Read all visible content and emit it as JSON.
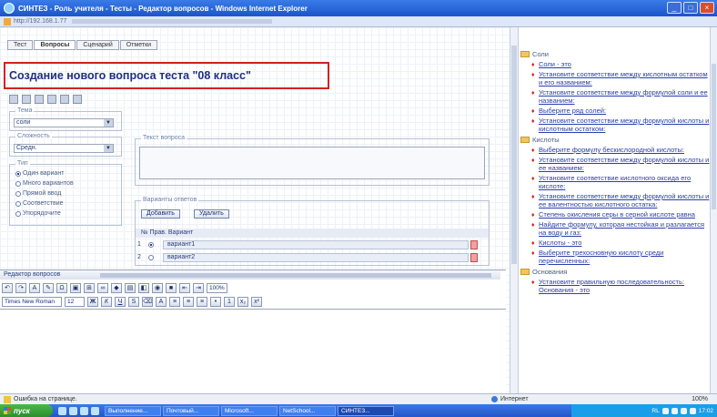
{
  "window": {
    "title": "СИНТЕЗ - Роль учителя - Тесты - Редактор вопросов - Windows Internet Explorer",
    "address": "http://192.168.1.77",
    "controls": [
      "_",
      "□",
      "×"
    ]
  },
  "tabs": [
    {
      "label": "Тест",
      "active": false
    },
    {
      "label": "Вопросы",
      "active": true
    },
    {
      "label": "Сценарий",
      "active": false
    },
    {
      "label": "Отметки",
      "active": false
    }
  ],
  "page_title": "Создание нового вопроса теста \"08 класс\"",
  "form": {
    "topic": {
      "legend": "Тема",
      "value": "соли"
    },
    "difficulty": {
      "legend": "Сложность",
      "value": "Средн."
    },
    "type": {
      "legend": "Тип",
      "options": [
        "Один вариант",
        "Много вариантов",
        "Прямой ввод",
        "Соответствие",
        "Упорядочите"
      ],
      "selected_index": 0
    },
    "question_text_legend": "Текст вопроса",
    "answers": {
      "legend": "Варианты ответов",
      "add_label": "Добавить",
      "delete_label": "Удалить",
      "header": "№ Прав. Вариант",
      "rows": [
        {
          "n": "1",
          "correct": true,
          "text": "вариант1"
        },
        {
          "n": "2",
          "correct": false,
          "text": "вариант2"
        }
      ]
    }
  },
  "editor": {
    "header": "Редактор вопросов",
    "font_name": "Times New Roman",
    "font_size": "12",
    "zoom": "100%",
    "row1_icons": [
      "undo-icon",
      "redo-icon",
      "font-color-icon",
      "highlight-icon",
      "special-char-icon",
      "image-icon",
      "table-icon",
      "link-icon",
      "flash-icon",
      "media-icon",
      "template-icon",
      "preview-icon",
      "source-icon",
      "outdent-icon",
      "indent-icon"
    ],
    "row2_icons": [
      "bold-icon",
      "italic-icon",
      "underline-icon",
      "strike-icon",
      "eraser-icon",
      "text-color-icon",
      "align-left-icon",
      "align-center-icon",
      "align-right-icon",
      "list-icon",
      "numbered-list-icon",
      "subscript-icon",
      "superscript-icon"
    ]
  },
  "sidebar": {
    "folders": [
      {
        "name": "Соли",
        "items": [
          "Соли - это",
          "Установите соответствие между кислотным остатком и его названием:",
          "Установите соответствие между формулой соли и ее названием:",
          "Выберите ряд солей:",
          "Установите соответствие между формулой кислоты и кислотным остатком:"
        ]
      },
      {
        "name": "Кислоты",
        "items": [
          "Выберите формулу бескислородной кислоты:",
          "Установите соответствие между формулой кислоты и ее названием:",
          "Установите соответствие кислотного оксида его кислоте:",
          "Установите соответствие между формулой кислоты и ее валентностью кислотного остатка:",
          "Степень окисления серы в серной кислоте равна",
          "Найдите формулу, которая нестойкая и разлагается на воду и газ:",
          "Кислоты - это",
          "Выберите трехосновную кислоту среди перечисленных:"
        ]
      },
      {
        "name": "Основания",
        "items": [
          "Установите правильную последовательность: Основания - это"
        ]
      }
    ]
  },
  "status": {
    "left": "Ошибка на странице.",
    "zone": "Интернет",
    "zoom": "100%"
  },
  "taskbar": {
    "start": "пуск",
    "tasks": [
      "Выполнение...",
      "Почтовый...",
      "Microsoft...",
      "NetSchool...",
      "СИНТЕЗ..."
    ],
    "lang": "RL",
    "clock": "17:02"
  }
}
